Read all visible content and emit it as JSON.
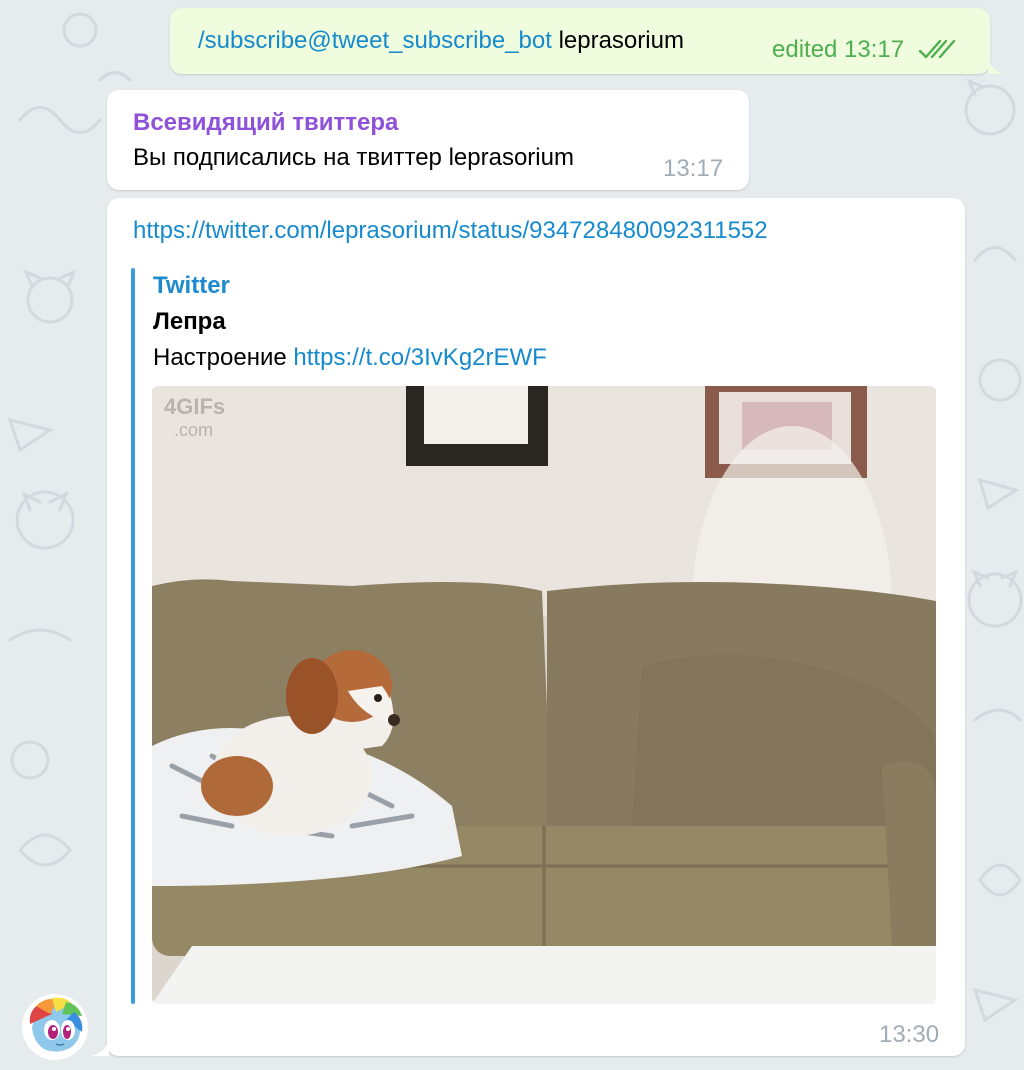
{
  "chat": {
    "outgoing": {
      "command": "/subscribe@tweet_subscribe_bot",
      "argument": "leprasorium",
      "status": "edited 13:17",
      "read_icon": "double-check-icon"
    },
    "bot_reply": {
      "sender": "Всевидящий твиттера",
      "text": "Вы подписались на твиттер leprasorium",
      "time": "13:17"
    },
    "tweet_message": {
      "url": "https://twitter.com/leprasorium/status/934728480092311552",
      "preview": {
        "site": "Twitter",
        "title": "Лепра",
        "description": "Настроение",
        "link": "https://t.co/3IvKg2rEWF",
        "media": {
          "watermark_line1": "4GIFs",
          "watermark_line2": ".com"
        }
      },
      "time": "13:30",
      "avatar_icon": "pony-avatar-icon"
    }
  },
  "colors": {
    "chat_background": "#e6ebee",
    "outgoing_bubble": "#effdde",
    "incoming_bubble": "#ffffff",
    "link": "#168acd",
    "sender_name": "#8e52d8",
    "edited_status": "#4fae4e",
    "timestamp": "#a0acb6"
  }
}
